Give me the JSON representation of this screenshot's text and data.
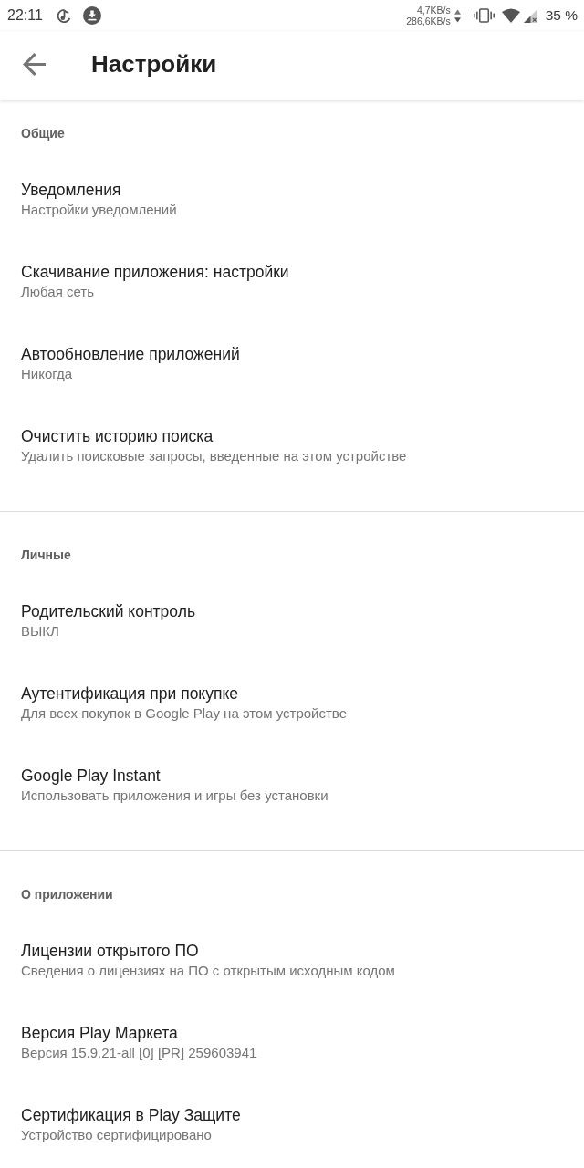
{
  "status_bar": {
    "time": "22:11",
    "upload_speed": "4,7KB/s",
    "download_speed": "286,6KB/s",
    "battery": "35 %"
  },
  "app_bar": {
    "title": "Настройки"
  },
  "sections": [
    {
      "header": "Общие",
      "items": [
        {
          "title": "Уведомления",
          "subtitle": "Настройки уведомлений"
        },
        {
          "title": "Скачивание приложения: настройки",
          "subtitle": "Любая сеть"
        },
        {
          "title": "Автообновление приложений",
          "subtitle": "Никогда"
        },
        {
          "title": "Очистить историю поиска",
          "subtitle": "Удалить поисковые запросы, введенные на этом устройстве"
        }
      ]
    },
    {
      "header": "Личные",
      "items": [
        {
          "title": "Родительский контроль",
          "subtitle": "ВЫКЛ"
        },
        {
          "title": "Аутентификация при покупке",
          "subtitle": "Для всех покупок в Google Play на этом устройстве"
        },
        {
          "title": "Google Play Instant",
          "subtitle": "Использовать приложения и игры без установки"
        }
      ]
    },
    {
      "header": "О приложении",
      "items": [
        {
          "title": "Лицензии открытого ПО",
          "subtitle": "Сведения о лицензиях на ПО с открытым исходным кодом"
        },
        {
          "title": "Версия Play Маркета",
          "subtitle": "Версия 15.9.21-all [0] [PR] 259603941"
        },
        {
          "title": "Сертификация в Play Защите",
          "subtitle": "Устройство сертифицировано"
        }
      ]
    }
  ]
}
